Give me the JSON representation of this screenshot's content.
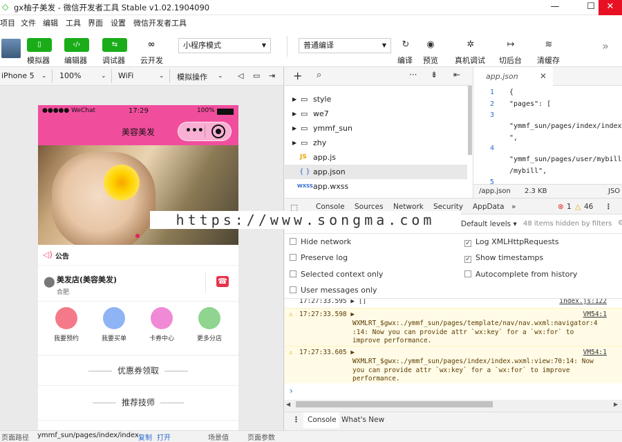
{
  "window": {
    "title": "gx柚子美发 - 微信开发者工具 Stable v1.02.1904090",
    "minimize": "—",
    "maximize": "☐",
    "close": "✕"
  },
  "menu": [
    "项目",
    "文件",
    "编辑",
    "工具",
    "界面",
    "设置",
    "微信开发者工具"
  ],
  "toolbar": {
    "buttons": [
      {
        "label": "模拟器",
        "icon": "simulator-icon"
      },
      {
        "label": "编辑器",
        "icon": "code-icon"
      },
      {
        "label": "调试器",
        "icon": "debugger-icon"
      },
      {
        "label": "云开发",
        "icon": "cloud-icon"
      }
    ],
    "mode_select": "小程序模式",
    "compile_select": "普通编译",
    "actions": [
      "编译",
      "预览",
      "真机调试",
      "切后台",
      "清缓存"
    ],
    "more": "»"
  },
  "device_bar": {
    "device": "iPhone 5",
    "zoom": "100%",
    "network": "WiFi",
    "simulate": "模拟操作"
  },
  "phone": {
    "status": {
      "carrier": "●●●●● WeChat",
      "time": "17:29",
      "battery": "100%"
    },
    "nav_title": "美容美发",
    "notice": "公告",
    "shop_name": "美发店(美容美发)",
    "shop_city": "合肥",
    "grid": [
      {
        "label": "我要预约",
        "color": "#f47a8a"
      },
      {
        "label": "我要买单",
        "color": "#8fb4f5"
      },
      {
        "label": "卡券中心",
        "color": "#f08ad6"
      },
      {
        "label": "更多分店",
        "color": "#8fd48f"
      }
    ],
    "sections": [
      "优惠券领取",
      "推荐技师"
    ]
  },
  "watermark": "https://www.songma.com",
  "file_tree": [
    {
      "name": "style",
      "type": "folder"
    },
    {
      "name": "we7",
      "type": "folder"
    },
    {
      "name": "ymmf_sun",
      "type": "folder"
    },
    {
      "name": "zhy",
      "type": "folder"
    },
    {
      "name": "app.js",
      "type": "js"
    },
    {
      "name": "app.json",
      "type": "json"
    },
    {
      "name": "app.wxss",
      "type": "wxss"
    }
  ],
  "editor": {
    "tab": "app.json",
    "lines": [
      {
        "n": "1",
        "text": "{"
      },
      {
        "n": "2",
        "text": "  \"pages\": ["
      },
      {
        "n": "3",
        "text": ""
      },
      {
        "n": "",
        "text": "\"ymmf_sun/pages/index/index"
      },
      {
        "n": "",
        "text": "\","
      },
      {
        "n": "4",
        "text": ""
      },
      {
        "n": "",
        "text": "\"ymmf_sun/pages/user/mybill"
      },
      {
        "n": "",
        "text": "/mybill\","
      },
      {
        "n": "5",
        "text": ""
      }
    ],
    "status_path": "/app.json",
    "status_size": "2.3 KB",
    "status_lang": "JSO"
  },
  "devtools": {
    "tabs": [
      "Console",
      "Sources",
      "Network",
      "Security",
      "AppData"
    ],
    "errors": "1",
    "warnings": "46",
    "levels": "Default levels ▾",
    "hidden": "48 items hidden by filters",
    "options_left": [
      {
        "label": "Hide network",
        "checked": false
      },
      {
        "label": "Preserve log",
        "checked": false
      },
      {
        "label": "Selected context only",
        "checked": false
      },
      {
        "label": "User messages only",
        "checked": false
      }
    ],
    "options_right": [
      {
        "label": "Log XMLHttpRequests",
        "checked": true
      },
      {
        "label": "Show timestamps",
        "checked": true
      },
      {
        "label": "Autocomplete from history",
        "checked": false
      }
    ],
    "log": [
      {
        "time": "17:27:33.595 ▶ []",
        "src": "index.js:122"
      },
      {
        "time": "17:27:33.598 ▶",
        "src": "VM54:1",
        "msg": "WXMLRT_$gwx:./ymmf_sun/pages/template/nav/nav.wxml:navigator:4\n:14: Now you can provide attr `wx:key` for a `wx:for` to\nimprove performance."
      },
      {
        "time": "17:27:33.605 ▶",
        "src": "VM54:1",
        "msg": "WXMLRT_$gwx:./ymmf_sun/pages/index/index.wxml:view:70:14: Now\nyou can provide attr `wx:key` for a `wx:for` to improve\nperformance."
      }
    ],
    "drawer_tabs": [
      "Console",
      "What's New"
    ]
  },
  "bottom": {
    "path_label": "页面路径",
    "path": "ymmf_sun/pages/index/index",
    "copy": "复制",
    "open": "打开",
    "scene": "场景值",
    "params": "页面参数"
  }
}
